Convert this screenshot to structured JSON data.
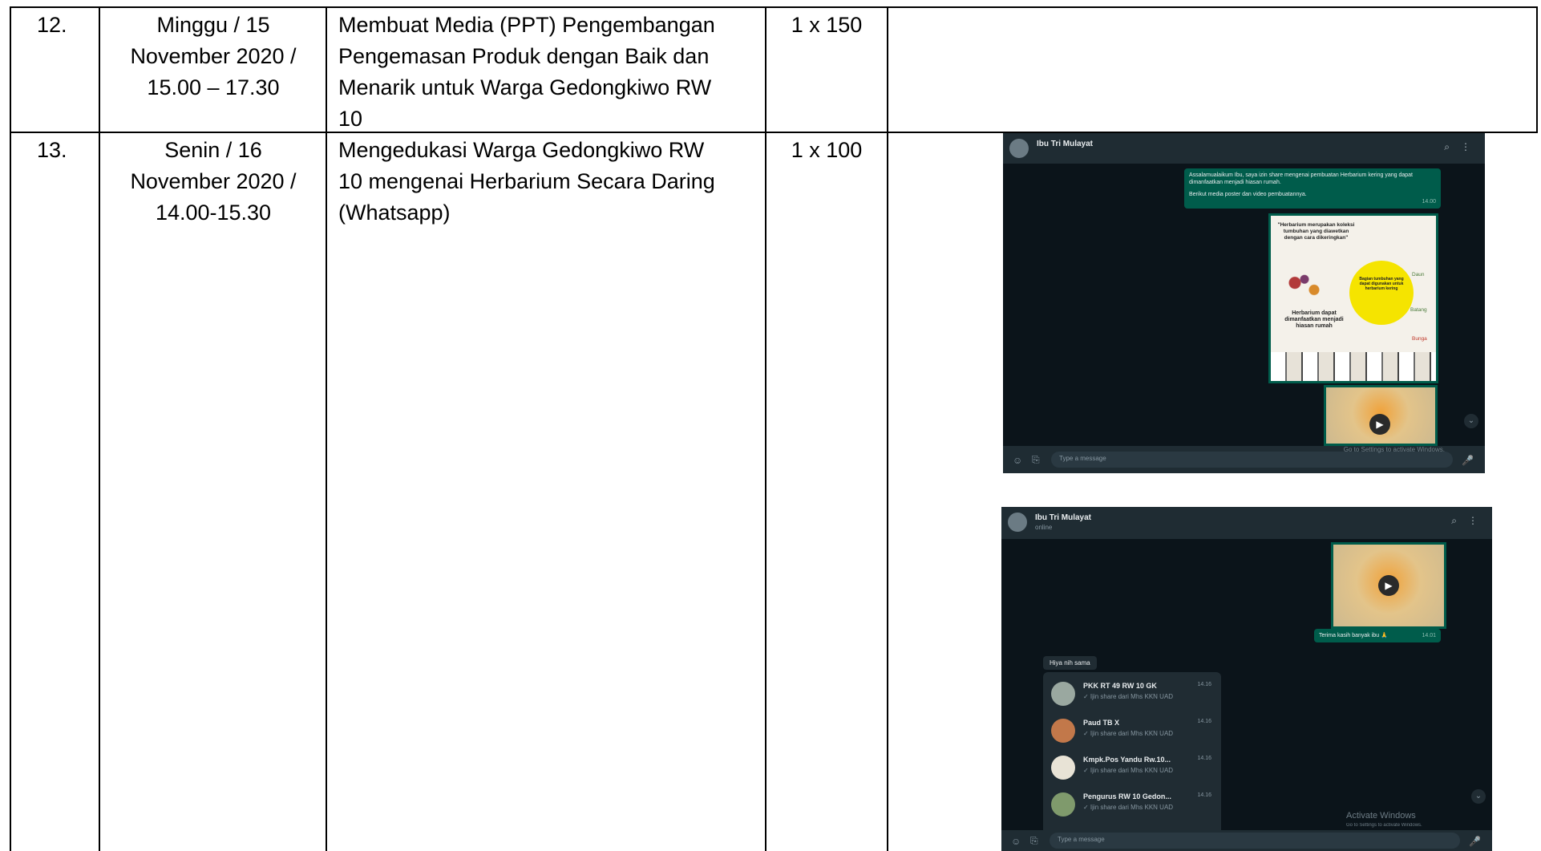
{
  "rows": [
    {
      "number": "12.",
      "date": "Minggu / 15\nNovember 2020 /\n15.00 – 17.30",
      "activity": "Membuat Media (PPT) Pengembangan\nPengemasan Produk dengan Baik dan\nMenarik untuk Warga Gedongkiwo RW\n10",
      "volume": "1 x 150"
    },
    {
      "number": "13.",
      "date": "Senin / 16\nNovember 2020 /\n14.00-15.30",
      "activity": "Mengedukasi Warga Gedongkiwo RW\n10 mengenai Herbarium Secara Daring\n(Whatsapp)",
      "volume": "1 x 100"
    }
  ],
  "screenshot1": {
    "contact": "Ibu Tri Mulayat",
    "message": "Assalamualaikum Ibu, saya izin share mengenai pembuatan Herbarium kering yang dapat dimanfaatkan menjadi hiasan rumah.",
    "message2": "Berikut media poster dan video pembuatannya.",
    "message_time": "14.00",
    "poster_title": "\"Herbarium merupakan koleksi tumbuhan yang diawetkan dengan cara dikeringkan\"",
    "poster_circle": "Bagian tumbuhan yang dapat digunakan untuk herbarium kering",
    "poster_bottom": "Herbarium dapat dimanfaatkan menjadi hiasan rumah",
    "poster_labels": [
      "Daun",
      "Batang",
      "Bunga"
    ],
    "input_placeholder": "Type a message",
    "watermark": "Go to Settings to activate Windows."
  },
  "screenshot2": {
    "contact": "Ibu Tri Mulayat",
    "status": "online",
    "reply": "Terima kasih banyak ibu 🙏",
    "reply_time": "14.01",
    "forward_header": "Hiya nih sama",
    "groups": [
      {
        "name": "PKK RT 49 RW 10 GK",
        "sub": "✓ Ijin share dari Mhs KKN UAD",
        "time": "14.16"
      },
      {
        "name": "Paud TB X",
        "sub": "✓ Ijin share dari Mhs KKN UAD",
        "time": "14.16"
      },
      {
        "name": "Kmpk.Pos Yandu Rw.10...",
        "sub": "✓ Ijin share dari Mhs KKN UAD",
        "time": "14.16"
      },
      {
        "name": "Pengurus RW 10 Gedon...",
        "sub": "✓ Ijin share dari Mhs KKN UAD",
        "time": "14.16"
      }
    ],
    "input_placeholder": "Type a message",
    "watermark_title": "Activate Windows",
    "watermark_sub": "Go to Settings to activate Windows."
  }
}
